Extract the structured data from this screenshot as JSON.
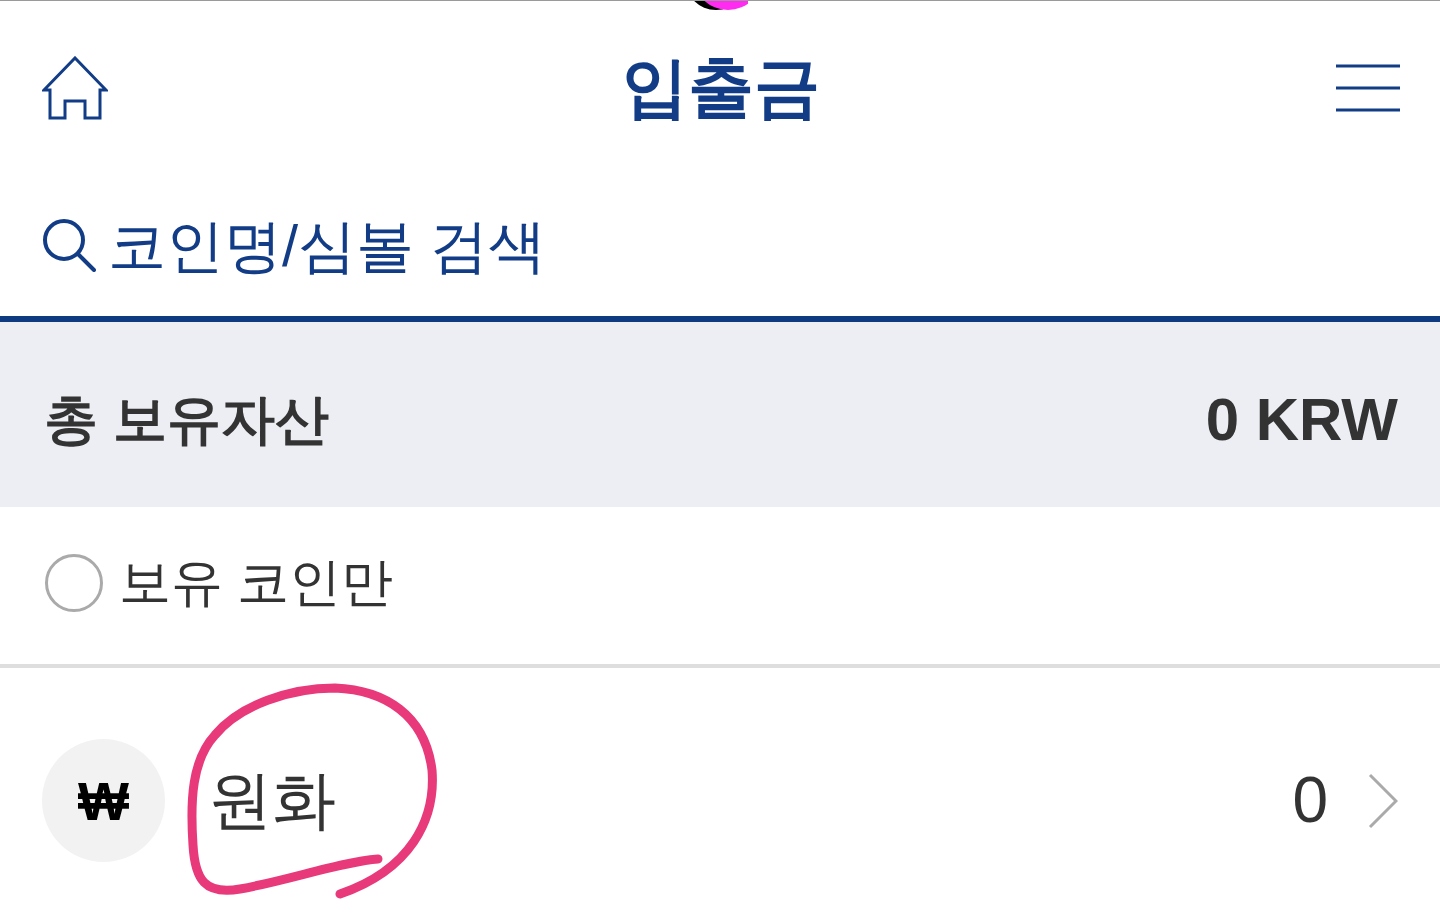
{
  "header": {
    "title": "입출금"
  },
  "search": {
    "placeholder": "코인명/심볼 검색"
  },
  "total_assets": {
    "label": "총 보유자산",
    "value": "0 KRW"
  },
  "filter": {
    "label": "보유 코인만",
    "checked": false
  },
  "assets": [
    {
      "symbol": "₩",
      "name": "원화",
      "amount": "0"
    }
  ]
}
